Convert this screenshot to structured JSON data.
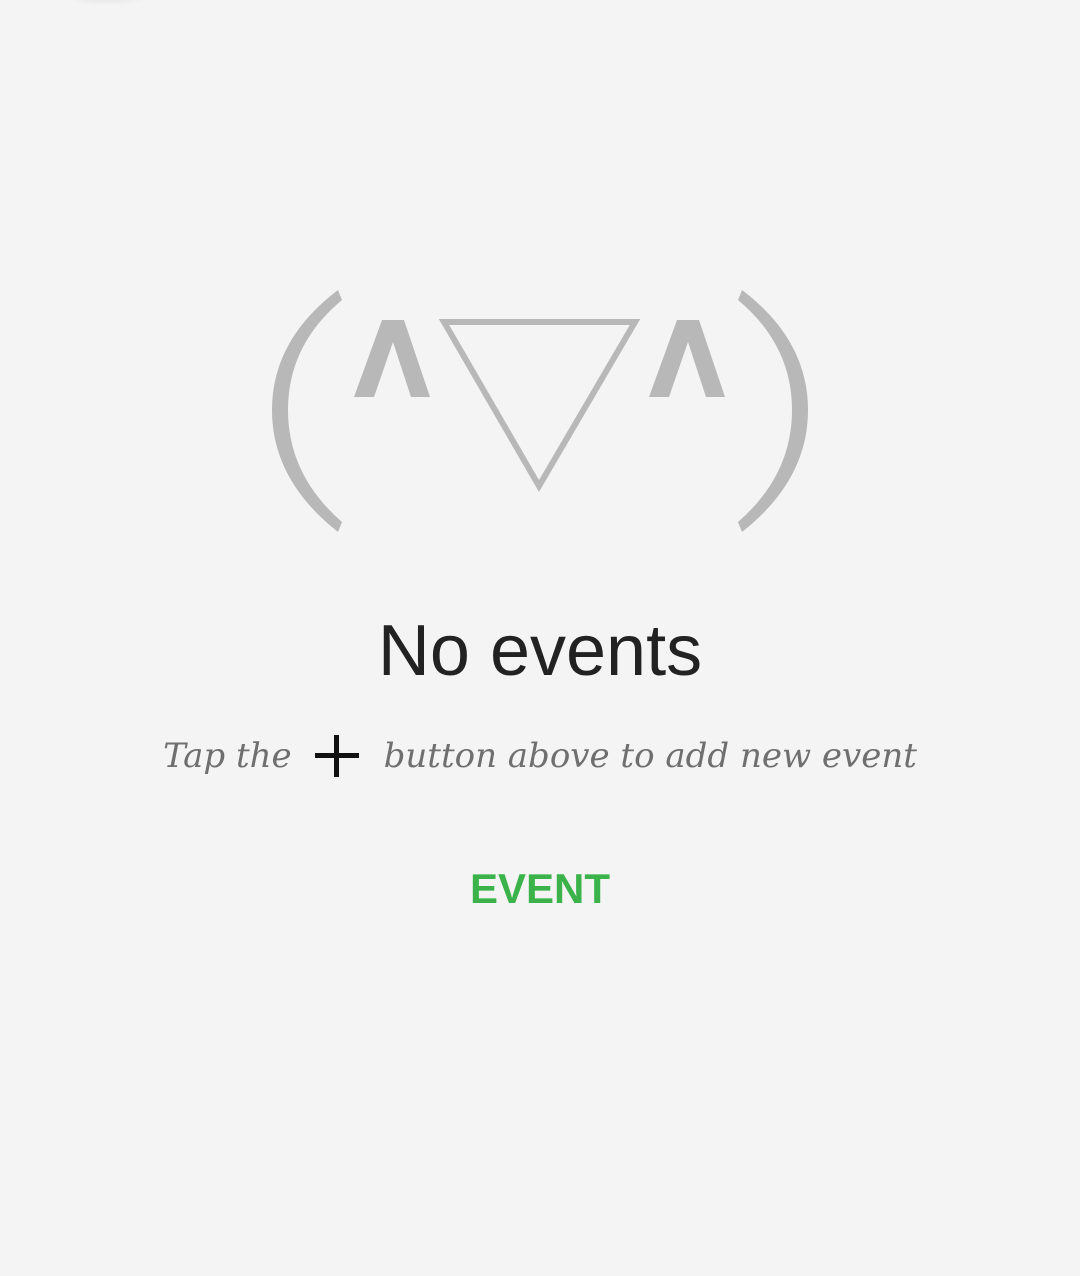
{
  "empty_state": {
    "emoticon": "(^▽^)",
    "title": "No events",
    "hint_before": "Tap the",
    "hint_after": "button above to add new event",
    "hint_icon": "plus-icon"
  },
  "action": {
    "label": "EVENT"
  },
  "colors": {
    "background": "#f4f4f4",
    "emoticon": "#b8b8b8",
    "title": "#222222",
    "hint": "#6f6f6f",
    "accent": "#3bb34a"
  }
}
